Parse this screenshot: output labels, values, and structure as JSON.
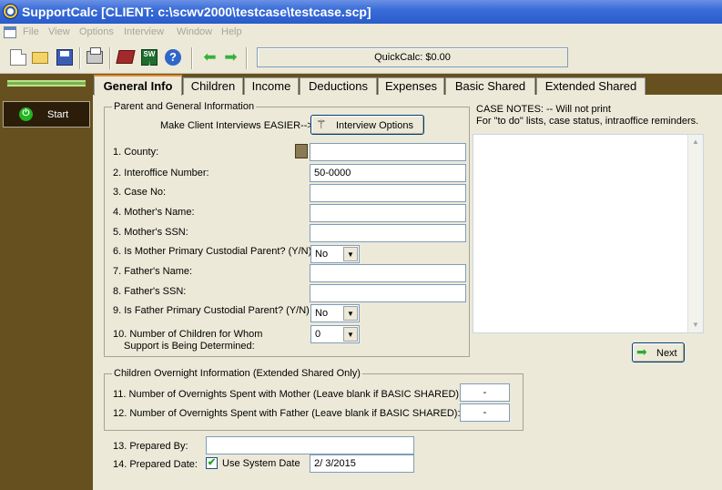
{
  "window": {
    "title": "SupportCalc  [CLIENT: c:\\scwv2000\\testcase\\testcase.scp]"
  },
  "menu": [
    "File",
    "View",
    "Options",
    "Interview",
    "Window",
    "Help"
  ],
  "toolbar": {
    "quickcalc": "QuickCalc: $0.00"
  },
  "sidebar": {
    "start_label": "Start"
  },
  "tabs": [
    "General Info",
    "Children",
    "Income",
    "Deductions",
    "Expenses",
    "Basic Shared",
    "Extended Shared"
  ],
  "parent_group": {
    "title": "Parent and General Information",
    "interview_hint": "Make Client Interviews EASIER-->",
    "interview_button": "Interview Options",
    "county_label": "1. County:",
    "county_value": "",
    "interoffice_label": "2. Interoffice Number:",
    "interoffice_value": "50-0000",
    "caseno_label": "3. Case No:",
    "caseno_value": "",
    "mother_name_label": "4. Mother's Name:",
    "mother_name_value": "",
    "mother_ssn_label": "5. Mother's SSN:",
    "mother_ssn_value": "",
    "mother_custodial_label": "6. Is Mother Primary Custodial Parent? (Y/N)",
    "mother_custodial_value": "No",
    "father_name_label": "7. Father's Name:",
    "father_name_value": "",
    "father_ssn_label": "8. Father's SSN:",
    "father_ssn_value": "",
    "father_custodial_label": "9. Is Father Primary Custodial Parent? (Y/N)",
    "father_custodial_value": "No",
    "children_count_label_1": "10. Number of Children for Whom",
    "children_count_label_2": "Support is Being Determined:",
    "children_count_value": "0"
  },
  "notes": {
    "heading": "CASE NOTES: -- Will not print",
    "subheading": "For \"to do\" lists, case status, intraoffice reminders.",
    "next_button": "Next"
  },
  "overnight_group": {
    "title": "Children Overnight Information (Extended Shared Only)",
    "mother_label": "11. Number of Overnights Spent with Mother (Leave blank if BASIC SHARED):",
    "mother_value": "-",
    "father_label": "12. Number of Overnights Spent with Father (Leave blank if BASIC SHARED):",
    "father_value": "-"
  },
  "prepared": {
    "by_label": "13. Prepared By:",
    "by_value": "",
    "date_label": "14. Prepared Date:",
    "use_system_date_label": "Use System Date",
    "use_system_date_checked": true,
    "date_value": "2/ 3/2015"
  }
}
